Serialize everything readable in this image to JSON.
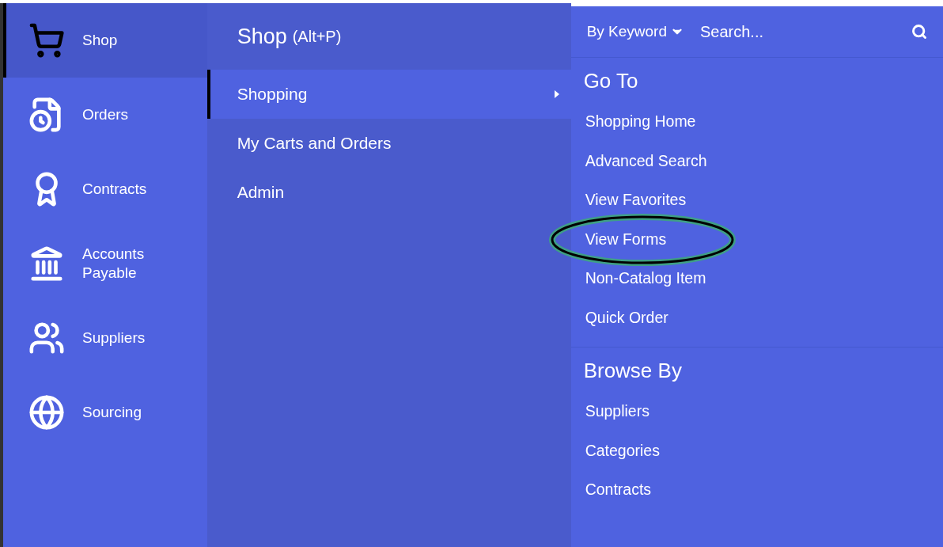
{
  "sidebar": {
    "items": [
      {
        "label": "Shop",
        "selected": true
      },
      {
        "label": "Orders",
        "selected": false
      },
      {
        "label": "Contracts",
        "selected": false
      },
      {
        "label": "Accounts Payable",
        "selected": false
      },
      {
        "label": "Suppliers",
        "selected": false
      },
      {
        "label": "Sourcing",
        "selected": false
      }
    ]
  },
  "submenu": {
    "title": "Shop",
    "shortcut": "(Alt+P)",
    "items": [
      {
        "label": "Shopping",
        "selected": true
      },
      {
        "label": "My Carts and Orders",
        "selected": false
      },
      {
        "label": "Admin",
        "selected": false
      }
    ]
  },
  "search": {
    "scope": "By Keyword",
    "placeholder": "Search..."
  },
  "sections": [
    {
      "heading": "Go To",
      "links": [
        {
          "label": "Shopping Home",
          "circled": false
        },
        {
          "label": "Advanced Search",
          "circled": false
        },
        {
          "label": "View Favorites",
          "circled": false
        },
        {
          "label": "View Forms",
          "circled": true
        },
        {
          "label": "Non-Catalog Item",
          "circled": false
        },
        {
          "label": "Quick Order",
          "circled": false
        }
      ]
    },
    {
      "heading": "Browse By",
      "links": [
        {
          "label": "Suppliers",
          "circled": false
        },
        {
          "label": "Categories",
          "circled": false
        },
        {
          "label": "Contracts",
          "circled": false
        }
      ]
    }
  ]
}
